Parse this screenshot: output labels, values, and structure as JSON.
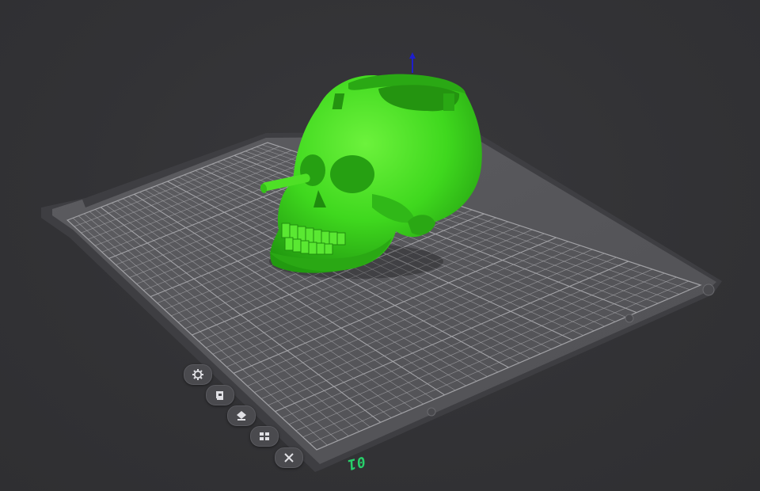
{
  "plate": {
    "label": "01",
    "label_color": "#27d16a"
  },
  "colors": {
    "background": "#333336",
    "bed": "#58585c",
    "grid": "#a8a8ac",
    "model": "#3fd81e",
    "axis": "#1e1ecc"
  },
  "model": {
    "name_icon": "skull-ashtray-model"
  },
  "toolbar": {
    "items": [
      {
        "icon": "gear-icon"
      },
      {
        "icon": "auto-orient-icon"
      },
      {
        "icon": "arrange-icon"
      },
      {
        "icon": "layers-icon"
      },
      {
        "icon": "close-icon"
      }
    ]
  }
}
